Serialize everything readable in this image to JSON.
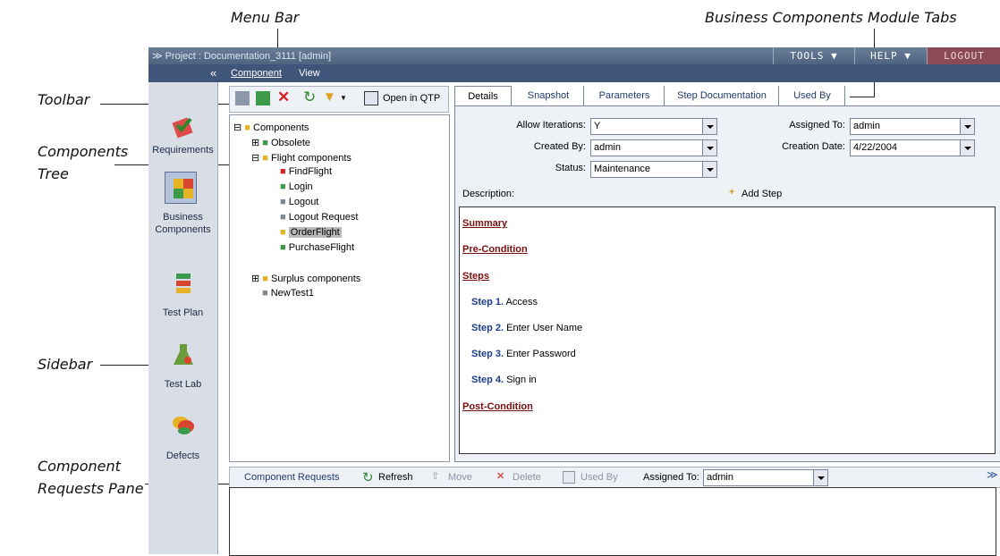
{
  "callouts": {
    "menu_bar": "Menu Bar",
    "module_tabs": "Business Components Module Tabs",
    "toolbar": "Toolbar",
    "components_tree_1": "Components",
    "components_tree_2": "Tree",
    "sidebar": "Sidebar",
    "requests_1": "Component",
    "requests_2": "Requests Pane"
  },
  "titlebar": {
    "project": "Project : Documentation_3111 [admin]",
    "tools": "TOOLS",
    "help": "HELP",
    "logout": "LOGOUT"
  },
  "menu": {
    "component": "Component",
    "view": "View"
  },
  "sidebar": {
    "requirements": "Requirements",
    "business_1": "Business",
    "business_2": "Components",
    "test_plan": "Test Plan",
    "test_lab": "Test Lab",
    "defects": "Defects"
  },
  "toolbar": {
    "open_in_qtp": "Open in QTP"
  },
  "tree": {
    "root": "Components",
    "obsolete": "Obsolete",
    "flight": "Flight components",
    "findflight": "FindFlight",
    "login": "Login",
    "logout": "Logout",
    "logout_request": "Logout Request",
    "orderflight": "OrderFlight",
    "purchaseflight": "PurchaseFlight",
    "surplus": "Surplus components",
    "newtest": "NewTest1"
  },
  "tabs": [
    "Details",
    "Snapshot",
    "Parameters",
    "Step Documentation",
    "Used By"
  ],
  "details": {
    "allow_iterations_label": "Allow Iterations:",
    "allow_iterations": "Y",
    "created_by_label": "Created By:",
    "created_by": "admin",
    "status_label": "Status:",
    "status": "Maintenance",
    "assigned_to_label": "Assigned To:",
    "assigned_to": "admin",
    "creation_date_label": "Creation Date:",
    "creation_date": "4/22/2004",
    "description_label": "Description:",
    "add_step": "Add Step"
  },
  "description": {
    "summary": "Summary",
    "pre_condition": "Pre-Condition",
    "steps": "Steps",
    "step_items": [
      {
        "num": "Step 1.",
        "text": " Access"
      },
      {
        "num": "Step 2.",
        "text": " Enter User Name"
      },
      {
        "num": "Step 3.",
        "text": " Enter Password"
      },
      {
        "num": "Step 4.",
        "text": " Sign in"
      }
    ],
    "post_condition": "Post-Condition"
  },
  "requests": {
    "title": "Component Requests",
    "refresh": "Refresh",
    "move": "Move",
    "delete": "Delete",
    "used_by": "Used By",
    "assigned_to_label": "Assigned To:",
    "assigned_to": "admin"
  }
}
